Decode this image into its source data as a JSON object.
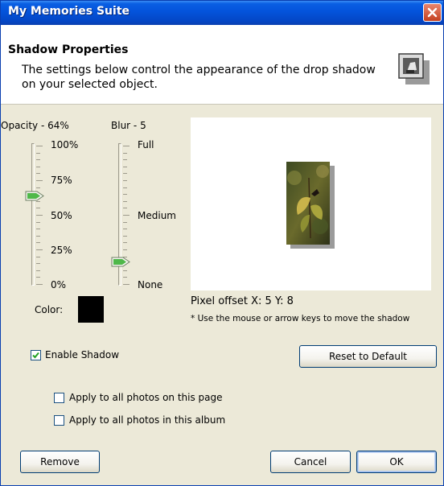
{
  "window": {
    "title": "My Memories Suite"
  },
  "header": {
    "title": "Shadow Properties",
    "description": "The settings below control the appearance of the drop shadow on your selected object.",
    "icon": "shadow-photo-icon"
  },
  "opacity": {
    "label": "Opacity - 64%",
    "value_percent": 64,
    "ticks": [
      "100%",
      "75%",
      "50%",
      "25%",
      "0%"
    ]
  },
  "blur": {
    "label": "Blur - 5",
    "value": 5,
    "ticks": [
      "Full",
      "Medium",
      "None"
    ]
  },
  "color": {
    "label": "Color:",
    "value": "#000000"
  },
  "preview": {
    "offset_label": "Pixel offset  X: 5  Y: 8",
    "hint": "* Use the mouse or arrow keys to move the shadow"
  },
  "options": {
    "enable_shadow": {
      "label": "Enable Shadow",
      "checked": true
    },
    "apply_page": {
      "label": "Apply to all photos on this page",
      "checked": false
    },
    "apply_album": {
      "label": "Apply to all photos in this album",
      "checked": false
    }
  },
  "buttons": {
    "reset": "Reset to Default",
    "remove": "Remove",
    "cancel": "Cancel",
    "ok": "OK"
  }
}
